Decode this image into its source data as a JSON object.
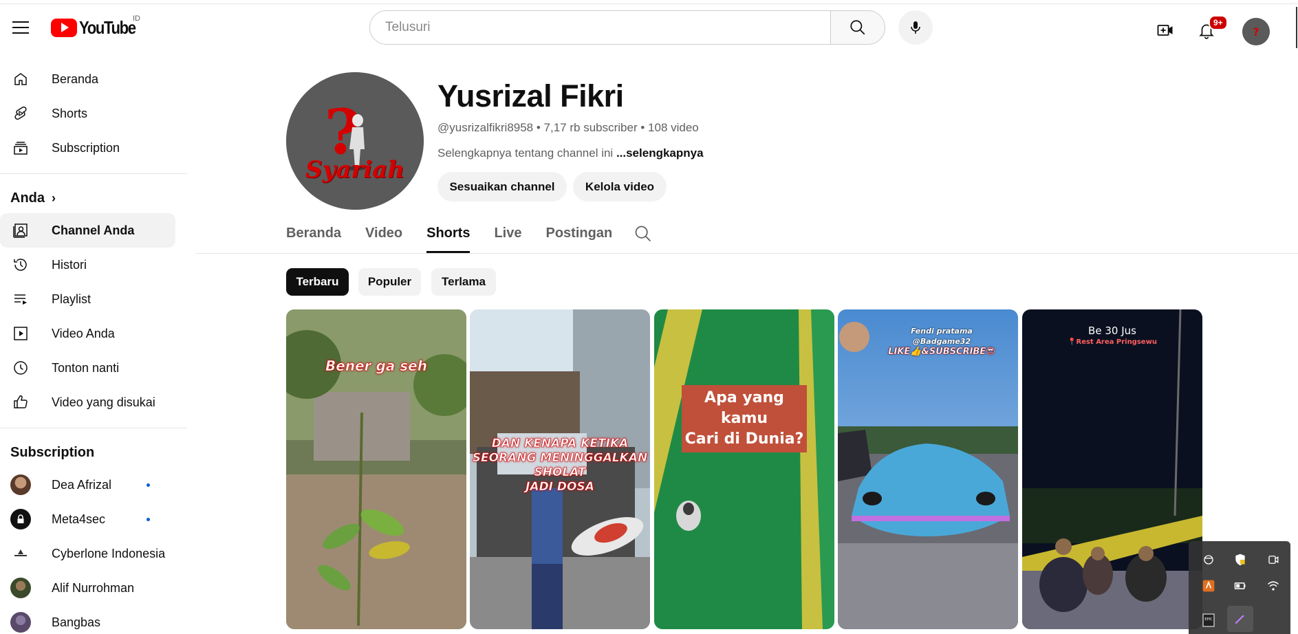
{
  "header": {
    "logo_text": "YouTube",
    "country_code": "ID",
    "search_placeholder": "Telusuri",
    "notification_count": "9+"
  },
  "sidebar": {
    "main": [
      {
        "label": "Beranda",
        "icon": "home-icon"
      },
      {
        "label": "Shorts",
        "icon": "shorts-icon"
      },
      {
        "label": "Subscription",
        "icon": "subscriptions-icon"
      }
    ],
    "you_heading": "Anda",
    "you": [
      {
        "label": "Channel Anda",
        "icon": "your-channel-icon",
        "active": true
      },
      {
        "label": "Histori",
        "icon": "history-icon"
      },
      {
        "label": "Playlist",
        "icon": "playlist-icon"
      },
      {
        "label": "Video Anda",
        "icon": "your-videos-icon"
      },
      {
        "label": "Tonton nanti",
        "icon": "watch-later-icon"
      },
      {
        "label": "Video yang disukai",
        "icon": "liked-icon"
      }
    ],
    "subs_heading": "Subscription",
    "subs": [
      {
        "label": "Dea Afrizal",
        "new": true
      },
      {
        "label": "Meta4sec",
        "new": true
      },
      {
        "label": "Cyberlone Indonesia",
        "new": false
      },
      {
        "label": "Alif Nurrohman",
        "new": false
      },
      {
        "label": "Bangbas",
        "new": false
      }
    ]
  },
  "channel": {
    "name": "Yusrizal Fikri",
    "handle": "@yusrizalfikri8958",
    "subscribers": "7,17 rb subscriber",
    "videos": "108 video",
    "description": "Selengkapnya tentang channel ini",
    "more_link": "...selengkapnya",
    "avatar_text": "Syariah",
    "customize_button": "Sesuaikan channel",
    "manage_button": "Kelola video"
  },
  "tabs": [
    {
      "label": "Beranda",
      "active": false
    },
    {
      "label": "Video",
      "active": false
    },
    {
      "label": "Shorts",
      "active": true
    },
    {
      "label": "Live",
      "active": false
    },
    {
      "label": "Postingan",
      "active": false
    }
  ],
  "chips": [
    {
      "label": "Terbaru",
      "active": true
    },
    {
      "label": "Populer",
      "active": false
    },
    {
      "label": "Terlama",
      "active": false
    }
  ],
  "shorts": [
    {
      "caption": "Bener ga seh"
    },
    {
      "caption_lines": [
        "DAN KENAPA KETIKA",
        "SEORANG MENINGGALKAN",
        "SHOLAT",
        "JADI DOSA"
      ]
    },
    {
      "caption_lines": [
        "Apa yang kamu",
        "Cari di Dunia?"
      ]
    },
    {
      "caption_lines": [
        "Fendi pratama",
        "@Badgame32",
        "LIKE👍&SUBSCRIBE😎"
      ]
    },
    {
      "caption": "Be 30 Jus",
      "subcaption": "📍Rest Area Pringsewu"
    }
  ],
  "colors": {
    "brand_red": "#ff0000",
    "badge_red": "#cc0000",
    "new_dot_blue": "#065fd4",
    "chip_active": "#0f0f0f"
  }
}
